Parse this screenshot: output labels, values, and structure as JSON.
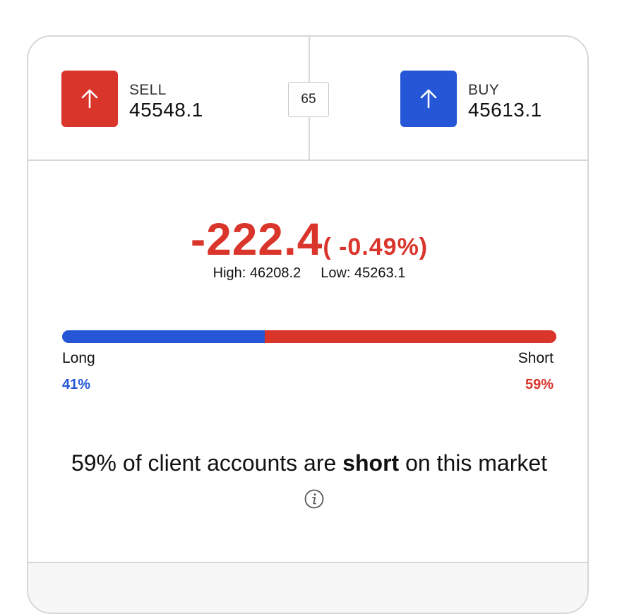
{
  "sell": {
    "label": "SELL",
    "price": "45548.1",
    "color": "#d9352b",
    "icon": "arrow-up-icon"
  },
  "buy": {
    "label": "BUY",
    "price": "45613.1",
    "color": "#2456d6",
    "icon": "arrow-up-icon"
  },
  "spread": "65",
  "change": {
    "value": "-222.4",
    "percent": "( -0.49%)",
    "color": "#d9352b"
  },
  "range": {
    "high": "High: 46208.2",
    "low": "Low: 45263.1"
  },
  "sentiment": {
    "long_label": "Long",
    "short_label": "Short",
    "long_pct": "41%",
    "short_pct": "59%",
    "long_fraction": 0.41,
    "short_fraction": 0.59,
    "long_color": "#2456d6",
    "short_color": "#d9352b"
  },
  "summary": {
    "prefix": "59% of client accounts are ",
    "emphasis": "short",
    "suffix": " on this market",
    "icon": "info-icon"
  }
}
